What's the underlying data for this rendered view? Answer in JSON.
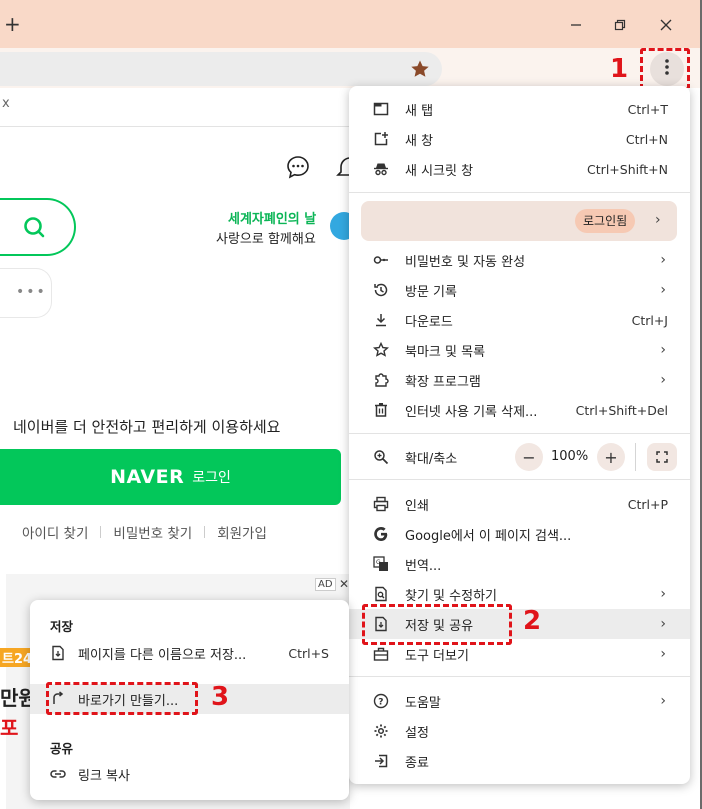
{
  "window": {
    "new_tab_label": "+",
    "minimize_label": "–",
    "close_label": "✕"
  },
  "page": {
    "infobar_close": "x",
    "campaign_title": "세계자폐인의 날",
    "campaign_sub": "사랑으로 함께해요",
    "more_dots": "•••",
    "secure_message": "네이버를 더 안전하고 편리하게 이용하세요",
    "naver_logo": "NAVER",
    "login_label": "로그인",
    "links": [
      "아이디 찾기",
      "비밀번호 찾기",
      "회원가입"
    ],
    "ad_label": "AD",
    "ad_close": "✕",
    "ad_peek": [
      "트24",
      "만원",
      "포"
    ]
  },
  "annotations": {
    "step1": "1",
    "step2": "2",
    "step3": "3"
  },
  "menu": {
    "new_tab": {
      "label": "새 탭",
      "shortcut": "Ctrl+T"
    },
    "new_window": {
      "label": "새 창",
      "shortcut": "Ctrl+N"
    },
    "incognito": {
      "label": "새 시크릿 창",
      "shortcut": "Ctrl+Shift+N"
    },
    "profile_login": "로그인됨",
    "passwords": {
      "label": "비밀번호 및 자동 완성"
    },
    "history": {
      "label": "방문 기록"
    },
    "downloads": {
      "label": "다운로드",
      "shortcut": "Ctrl+J"
    },
    "bookmarks": {
      "label": "북마크 및 목록"
    },
    "extensions": {
      "label": "확장 프로그램"
    },
    "clear_data": {
      "label": "인터넷 사용 기록 삭제...",
      "shortcut": "Ctrl+Shift+Del"
    },
    "zoom": {
      "label": "확대/축소",
      "minus": "−",
      "value": "100%",
      "plus": "+"
    },
    "print": {
      "label": "인쇄",
      "shortcut": "Ctrl+P"
    },
    "google_search": {
      "label": "Google에서 이 페이지 검색..."
    },
    "translate": {
      "label": "번역..."
    },
    "find_edit": {
      "label": "찾기 및 수정하기"
    },
    "save_share": {
      "label": "저장 및 공유"
    },
    "more_tools": {
      "label": "도구 더보기"
    },
    "help": {
      "label": "도움말"
    },
    "settings": {
      "label": "설정"
    },
    "exit": {
      "label": "종료"
    },
    "chevron": "›"
  },
  "submenu": {
    "save_heading": "저장",
    "save_page_as": {
      "label": "페이지를 다른 이름으로 저장...",
      "shortcut": "Ctrl+S"
    },
    "create_shortcut": {
      "label": "바로가기 만들기..."
    },
    "share_heading": "공유",
    "copy_link": {
      "label": "링크 복사"
    }
  },
  "colors": {
    "titlebar": "#f9d9c8",
    "naver_green": "#03c75a",
    "annotation_red": "#e0141a"
  }
}
